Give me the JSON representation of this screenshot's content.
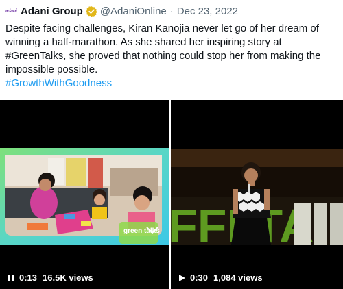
{
  "tweet": {
    "avatar_text": "adani",
    "author_name": "Adani Group",
    "handle": "@AdaniOnline",
    "separator": "·",
    "date": "Dec 23, 2022",
    "text_lines": [
      "Despite facing challenges, Kiran Kanojia never let go of her dream of",
      "winning a half-marathon. As she shared her inspiring story at",
      "#GreenTalks, she proved that nothing could stop her from making the",
      "impossible possible.",
      "#GrowthWithGoodness"
    ],
    "hashtag_color": "#1d9bf0",
    "verified_color": "#e2b719"
  },
  "videos": [
    {
      "state_icon": "pause-icon",
      "time": "0:13",
      "views": "16.5K views",
      "overlay_logo": "green talks"
    },
    {
      "state_icon": "play-icon",
      "time": "0:30",
      "views": "1,084 views",
      "stage_text": "FFI TA"
    }
  ]
}
